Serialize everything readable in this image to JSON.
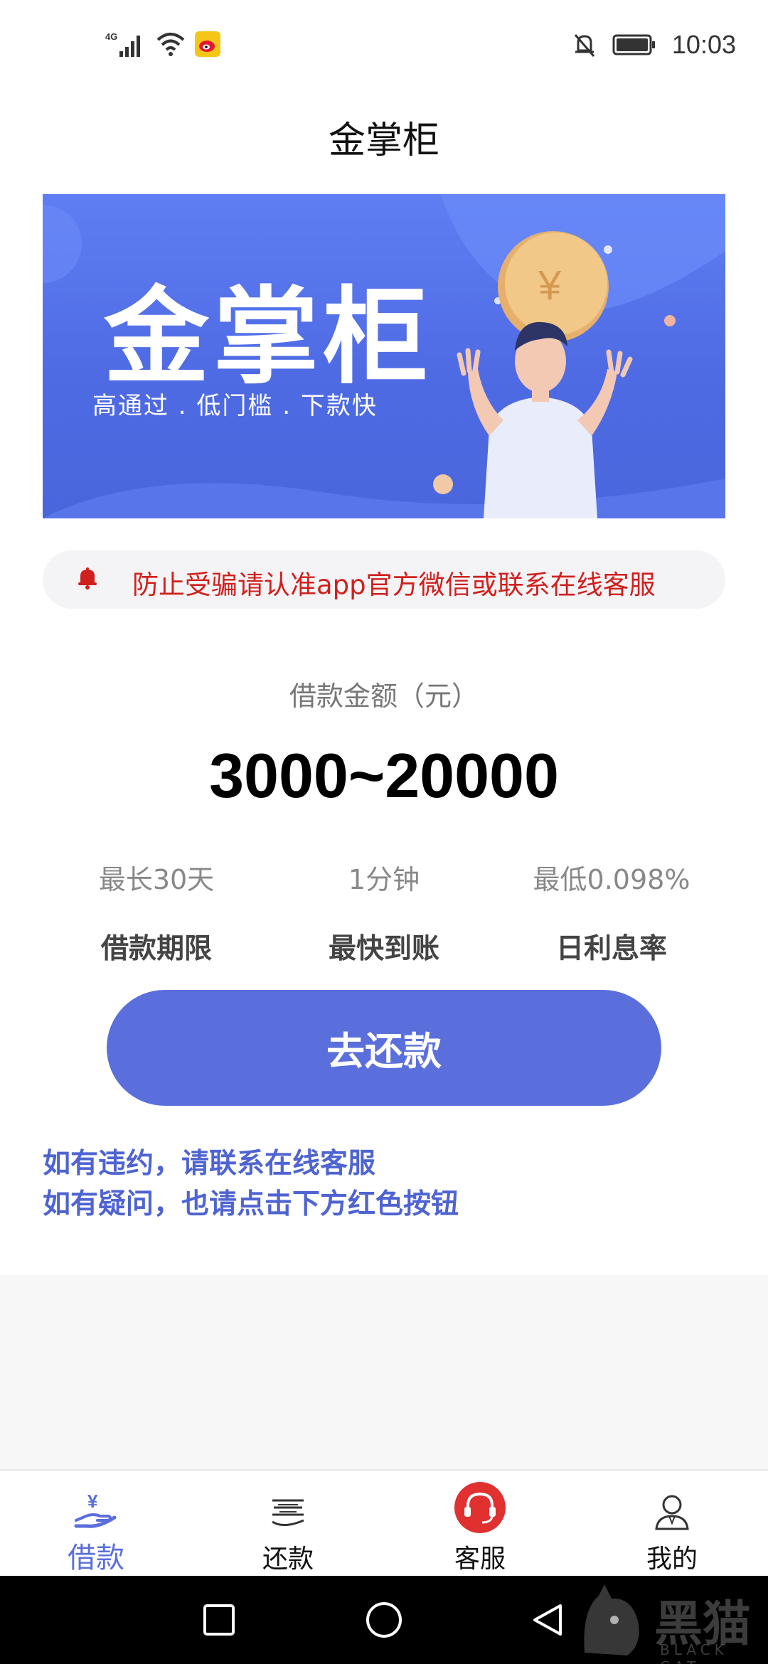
{
  "status_bar": {
    "network": "4G",
    "time": "10:03",
    "icons": [
      "signal-icon",
      "wifi-icon",
      "weibo-icon",
      "mute-bell-icon",
      "battery-icon"
    ]
  },
  "header": {
    "title": "金掌柜"
  },
  "banner": {
    "title": "金掌柜",
    "subtitle": "高通过 . 低门槛 . 下款快",
    "coin_symbol": "¥"
  },
  "notice": {
    "text": "防止受骗请认准app官方微信或联系在线客服"
  },
  "loan": {
    "amount_label": "借款金额（元）",
    "amount_range": "3000~20000",
    "stats": [
      {
        "value": "最长30天",
        "label": "借款期限"
      },
      {
        "value": "1分钟",
        "label": "最快到账"
      },
      {
        "value": "最低0.098%",
        "label": "日利息率"
      }
    ]
  },
  "action": {
    "repay_label": "去还款"
  },
  "tips": {
    "line1": "如有违约，请联系在线客服",
    "line2": "如有疑问，也请点击下方红色按钮"
  },
  "tabbar": {
    "items": [
      {
        "label": "借款",
        "icon": "loan-yen-hand-icon",
        "active": true
      },
      {
        "label": "还款",
        "icon": "repay-stack-icon",
        "active": false
      },
      {
        "label": "客服",
        "icon": "headset-icon",
        "active": false
      },
      {
        "label": "我的",
        "icon": "profile-icon",
        "active": false
      }
    ]
  },
  "colors": {
    "accent": "#5b6fdc",
    "notice_red": "#d0201e",
    "banner_blue": "#4f6be4",
    "service_red": "#e03030"
  },
  "watermark": {
    "text": "黑猫",
    "sub": "BLACK CAT"
  }
}
